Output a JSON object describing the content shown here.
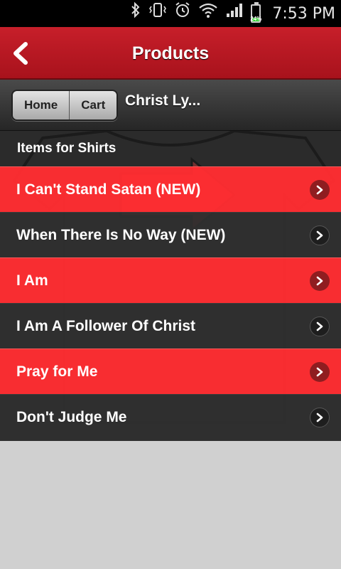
{
  "status_bar": {
    "time": "7:53 PM",
    "battery_percent": "24%",
    "battery_level": 0.24,
    "icons": [
      "bluetooth-icon",
      "vibrate-icon",
      "alarm-icon",
      "wifi-icon",
      "signal-icon",
      "battery-icon"
    ]
  },
  "header": {
    "title": "Products",
    "back_icon": "chevron-left-icon",
    "color": "#b81a23"
  },
  "toolbar": {
    "home_label": "Home",
    "cart_label": "Cart",
    "title": "Christ Ly..."
  },
  "list": {
    "header": "Items for Shirts",
    "items": [
      {
        "label": "I Can't Stand Satan (NEW)",
        "style": "red"
      },
      {
        "label": "When There Is No Way (NEW)",
        "style": "dark"
      },
      {
        "label": "I Am",
        "style": "red"
      },
      {
        "label": "I Am A Follower Of Christ",
        "style": "dark"
      },
      {
        "label": "Pray for Me",
        "style": "red"
      },
      {
        "label": "Don't Judge Me",
        "style": "dark"
      }
    ],
    "accent_red": "#ff2d32",
    "dark_row": "#303030"
  }
}
